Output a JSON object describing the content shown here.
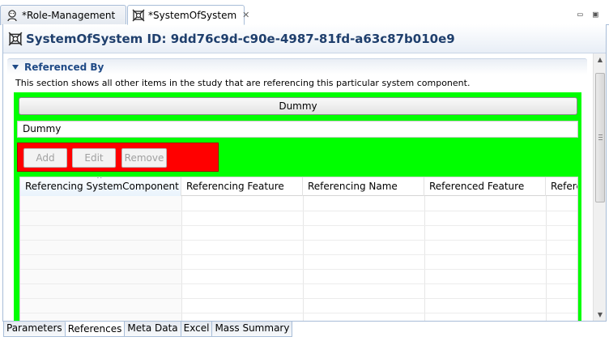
{
  "tabs": [
    {
      "label": "*Role-Management",
      "icon": "role-icon",
      "active": false
    },
    {
      "label": "*SystemOfSystem",
      "icon": "system-icon",
      "active": true
    }
  ],
  "window_controls": {
    "minimize": "▭",
    "maximize": "▣"
  },
  "header": {
    "title": "SystemOfSystem ID: 9dd76c9d-c90e-4987-81fd-a63c87b010e9"
  },
  "section": {
    "title": "Referenced By",
    "description": "This section shows all other items in the study that are referencing this particular system component."
  },
  "dummy_button_label": "Dummy",
  "dummy_field_value": "Dummy",
  "actions": {
    "add": "Add",
    "edit": "Edit",
    "remove": "Remove"
  },
  "table": {
    "columns": [
      "Referencing SystemComponent",
      "Referencing Feature",
      "Referencing Name",
      "Referenced Feature",
      "Refere"
    ],
    "sort_indicator": "^"
  },
  "bottom_tabs": [
    "Parameters",
    "References",
    "Meta Data",
    "Excel",
    "Mass Summary"
  ],
  "active_bottom_tab": "References",
  "colors": {
    "green_container": "#00ff00",
    "red_container": "#ff0000",
    "header_title": "#1f3f6d",
    "section_title": "#1f4a86"
  }
}
